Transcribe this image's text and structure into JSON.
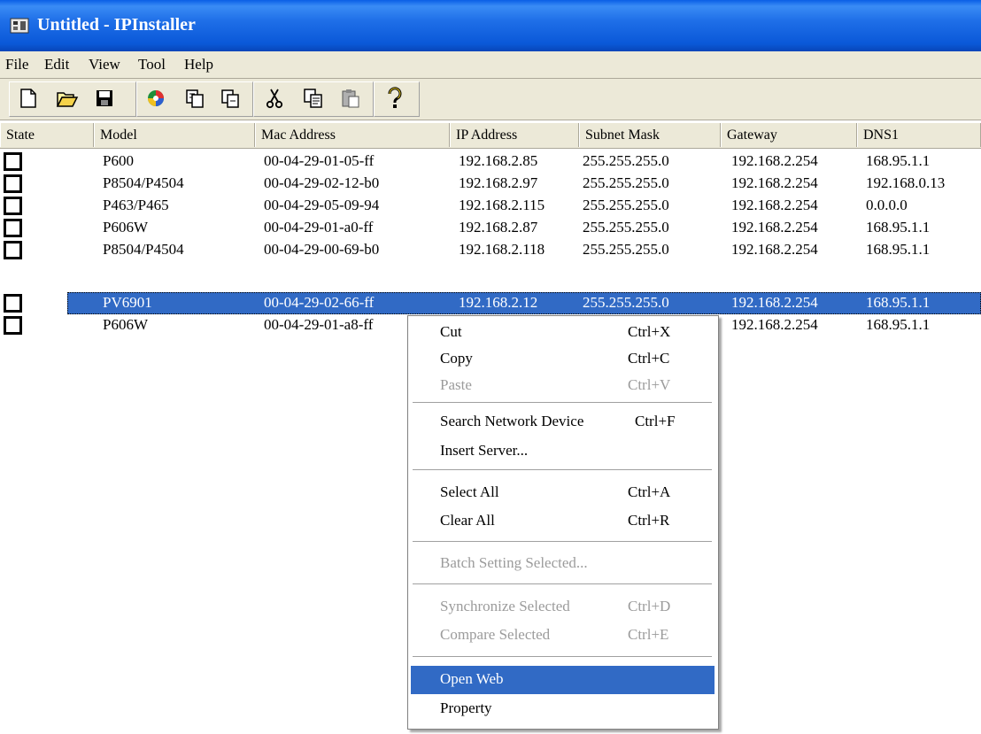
{
  "window": {
    "title": "Untitled - IPInstaller"
  },
  "menubar": {
    "items": [
      "File",
      "Edit",
      "View",
      "Tool",
      "Help"
    ]
  },
  "toolbar": {
    "buttons": [
      "new-icon",
      "open-icon",
      "save-icon",
      "search-network-icon",
      "insert-server-icon",
      "remove-server-icon",
      "cut-icon",
      "copy-icon",
      "paste-icon",
      "help-icon"
    ]
  },
  "table": {
    "columns": [
      "State",
      "Model",
      "Mac Address",
      "IP Address",
      "Subnet Mask",
      "Gateway",
      "DNS1"
    ],
    "rows": [
      {
        "model": "P600",
        "mac": "00-04-29-01-05-ff",
        "ip": "192.168.2.85",
        "mask": "255.255.255.0",
        "gw": "192.168.2.254",
        "dns": "168.95.1.1",
        "selected": false
      },
      {
        "model": "P8504/P4504",
        "mac": "00-04-29-02-12-b0",
        "ip": "192.168.2.97",
        "mask": "255.255.255.0",
        "gw": "192.168.2.254",
        "dns": "192.168.0.13",
        "selected": false
      },
      {
        "model": "P463/P465",
        "mac": "00-04-29-05-09-94",
        "ip": "192.168.2.115",
        "mask": "255.255.255.0",
        "gw": "192.168.2.254",
        "dns": "0.0.0.0",
        "selected": false
      },
      {
        "model": "P606W",
        "mac": "00-04-29-01-a0-ff",
        "ip": "192.168.2.87",
        "mask": "255.255.255.0",
        "gw": "192.168.2.254",
        "dns": "168.95.1.1",
        "selected": false
      },
      {
        "model": "P8504/P4504",
        "mac": "00-04-29-00-69-b0",
        "ip": "192.168.2.118",
        "mask": "255.255.255.0",
        "gw": "192.168.2.254",
        "dns": "168.95.1.1",
        "selected": false
      },
      {
        "model": "PV6901",
        "mac": "00-04-29-02-66-ff",
        "ip": "192.168.2.12",
        "mask": "255.255.255.0",
        "gw": "192.168.2.254",
        "dns": "168.95.1.1",
        "selected": true
      },
      {
        "model": "P606W",
        "mac": "00-04-29-01-a8-ff",
        "ip": "",
        "mask": "",
        "gw": "192.168.2.254",
        "dns": "168.95.1.1",
        "selected": false
      }
    ]
  },
  "context_menu": {
    "items": [
      {
        "label": "Cut",
        "shortcut": "Ctrl+X",
        "disabled": false
      },
      {
        "label": "Copy",
        "shortcut": "Ctrl+C",
        "disabled": false
      },
      {
        "label": "Paste",
        "shortcut": "Ctrl+V",
        "disabled": true
      },
      {
        "label": "Search Network Device",
        "shortcut": "Ctrl+F",
        "disabled": false
      },
      {
        "label": "Insert Server...",
        "shortcut": "",
        "disabled": false
      },
      {
        "label": "Select All",
        "shortcut": "Ctrl+A",
        "disabled": false
      },
      {
        "label": "Clear All",
        "shortcut": "Ctrl+R",
        "disabled": false
      },
      {
        "label": "Batch Setting Selected...",
        "shortcut": "",
        "disabled": true
      },
      {
        "label": "Synchronize Selected",
        "shortcut": "Ctrl+D",
        "disabled": true
      },
      {
        "label": "Compare Selected",
        "shortcut": "Ctrl+E",
        "disabled": true
      },
      {
        "label": "Open Web",
        "shortcut": "",
        "disabled": false,
        "highlighted": true
      },
      {
        "label": "Property",
        "shortcut": "",
        "disabled": false
      }
    ]
  },
  "colors": {
    "title_blue": "#0a58d8",
    "selection": "#316ac5",
    "chrome": "#ece9d8"
  }
}
